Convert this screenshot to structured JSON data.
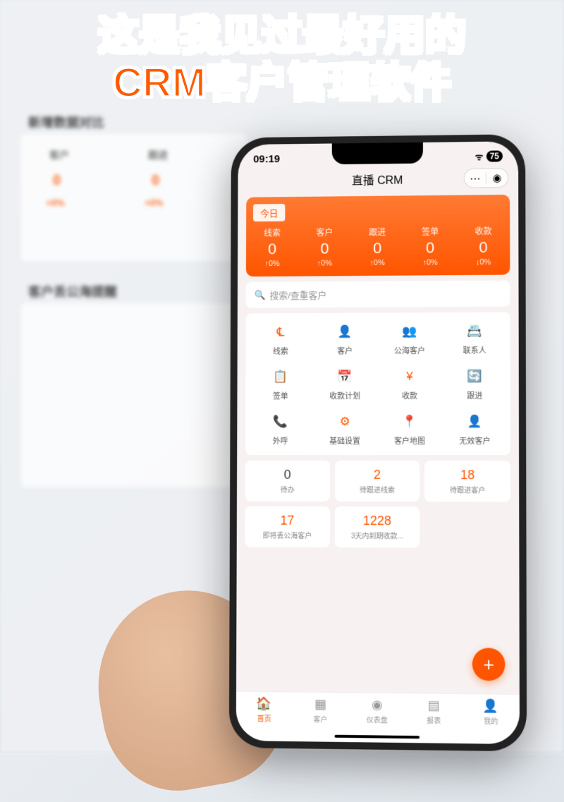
{
  "headline": {
    "line1": "这是我见过最好用的",
    "line2": "CRM客户管理软件"
  },
  "statusBar": {
    "time": "09:19",
    "battery": "75"
  },
  "appTitle": "直播 CRM",
  "orangeCard": {
    "todayLabel": "今日",
    "metrics": [
      {
        "label": "线索",
        "value": "0",
        "change": "↑0%"
      },
      {
        "label": "客户",
        "value": "0",
        "change": "↑0%"
      },
      {
        "label": "跟进",
        "value": "0",
        "change": "↑0%"
      },
      {
        "label": "签单",
        "value": "0",
        "change": "↑0%"
      },
      {
        "label": "收款",
        "value": "0",
        "change": "↓0%"
      }
    ]
  },
  "search": {
    "placeholder": "搜索/查重客户"
  },
  "gridMenu": [
    {
      "label": "线索",
      "color": "#ff5500",
      "icon": "℄"
    },
    {
      "label": "客户",
      "color": "#ff5500",
      "icon": "👤"
    },
    {
      "label": "公海客户",
      "color": "#3a7afe",
      "icon": "👥"
    },
    {
      "label": "联系人",
      "color": "#3a7afe",
      "icon": "📇"
    },
    {
      "label": "签单",
      "color": "#ff5500",
      "icon": "📋"
    },
    {
      "label": "收款计划",
      "color": "#3a7afe",
      "icon": "📅"
    },
    {
      "label": "收款",
      "color": "#ff5500",
      "icon": "¥"
    },
    {
      "label": "跟进",
      "color": "#4ab5a0",
      "icon": "🔄"
    },
    {
      "label": "外呼",
      "color": "#4ab5a0",
      "icon": "📞"
    },
    {
      "label": "基础设置",
      "color": "#ff5500",
      "icon": "⚙"
    },
    {
      "label": "客户地图",
      "color": "#ff5500",
      "icon": "📍"
    },
    {
      "label": "无效客户",
      "color": "#bbb",
      "icon": "👤"
    }
  ],
  "statCards": [
    {
      "value": "0",
      "label": "待办",
      "orange": false
    },
    {
      "value": "2",
      "label": "待跟进线索",
      "orange": true
    },
    {
      "value": "18",
      "label": "待跟进客户",
      "orange": true
    },
    {
      "value": "17",
      "label": "即将丢公海客户",
      "orange": true
    },
    {
      "value": "1228",
      "label": "3天内到期收款...",
      "orange": true
    }
  ],
  "tabbar": [
    {
      "label": "首页",
      "icon": "🏠",
      "active": true
    },
    {
      "label": "客户",
      "icon": "▦",
      "active": false
    },
    {
      "label": "仪表盘",
      "icon": "◉",
      "active": false
    },
    {
      "label": "报表",
      "icon": "▤",
      "active": false
    },
    {
      "label": "我的",
      "icon": "👤",
      "active": false
    }
  ],
  "bg": {
    "section1Title": "新增数据对比",
    "col1": "客户",
    "col2": "跟进",
    "val": "0",
    "pct": "+0%",
    "section2Title": "客户丢公海提醒"
  }
}
